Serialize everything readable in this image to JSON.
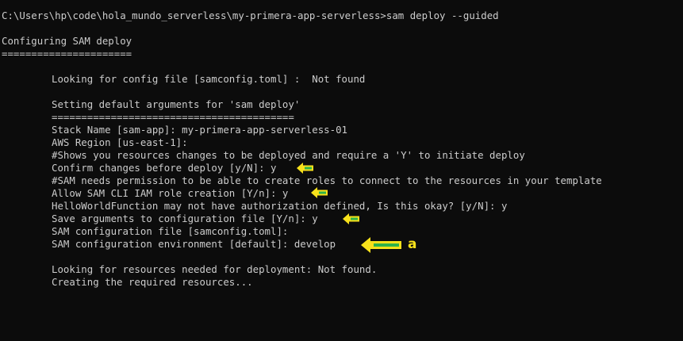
{
  "terminal": {
    "prompt_line": "C:\\Users\\hp\\code\\hola_mundo_serverless\\my-primera-app-serverless>sam deploy --guided",
    "heading": "Configuring SAM deploy",
    "heading_rule": "======================",
    "config_lookup": "Looking for config file [samconfig.toml] :  Not found",
    "defaults_heading": "Setting default arguments for 'sam deploy'",
    "defaults_rule": "=========================================",
    "stack_name": "Stack Name [sam-app]: my-primera-app-serverless-01",
    "aws_region": "AWS Region [us-east-1]:",
    "shows_changes_comment": "#Shows you resources changes to be deployed and require a 'Y' to initiate deploy",
    "confirm_changes": "Confirm changes before deploy [y/N]: y",
    "iam_comment": "#SAM needs permission to be able to create roles to connect to the resources in your template",
    "allow_iam": "Allow SAM CLI IAM role creation [Y/n]: y",
    "auth_warning": "HelloWorldFunction may not have authorization defined, Is this okay? [y/N]: y",
    "save_args": "Save arguments to configuration file [Y/n]: y",
    "config_file": "SAM configuration file [samconfig.toml]:",
    "config_env": "SAM configuration environment [default]: develop",
    "looking_resources": "Looking for resources needed for deployment: Not found.",
    "creating_resources": "Creating the required resources..."
  },
  "annotations": {
    "label_a": "a",
    "arrow_fill": "#f7e11b",
    "arrow_accent": "#2fb24a"
  },
  "colors": {
    "background": "#0c0c0c",
    "text": "#cccccc"
  }
}
